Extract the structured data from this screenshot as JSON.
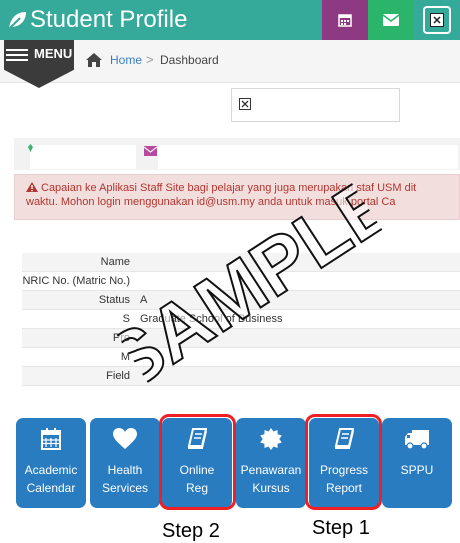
{
  "header": {
    "title": "Student Profile"
  },
  "menu": {
    "label": "MENU"
  },
  "breadcrumb": {
    "home": "Home",
    "separator": ">",
    "current": "Dashboard"
  },
  "alert": {
    "line1": "Capaian ke Aplikasi Staff Site bagi pelajar yang juga merupakan staf USM dit",
    "line2": "waktu. Mohon login menggunakan id@usm.my anda untuk masuk portal Ca"
  },
  "profile": {
    "rows": [
      {
        "label": "Name",
        "value": ""
      },
      {
        "label": "NRIC No. (Matric No.)",
        "value": ""
      },
      {
        "label": "Status",
        "value": "A"
      },
      {
        "label": "S",
        "value": "Graduate School of Business"
      },
      {
        "label": "Pro",
        "value": ""
      },
      {
        "label": "M",
        "value": ""
      },
      {
        "label": "Field",
        "value": ""
      }
    ]
  },
  "tiles": [
    {
      "icon": "calendar-icon",
      "line1": "Academic",
      "line2": "Calendar"
    },
    {
      "icon": "heart-icon",
      "line1": "Health",
      "line2": "Services"
    },
    {
      "icon": "book-icon",
      "line1": "Online",
      "line2": "Reg"
    },
    {
      "icon": "badge-icon",
      "line1": "Penawaran",
      "line2": "Kursus"
    },
    {
      "icon": "book-icon",
      "line1": "Progress",
      "line2": "Report"
    },
    {
      "icon": "truck-icon",
      "line1": "SPPU",
      "line2": ""
    }
  ],
  "annotations": {
    "step2": "Step 2",
    "step1": "Step 1"
  },
  "watermark": "SAMPLE",
  "colors": {
    "header": "#35a99a",
    "calendar_button": "#8e3a83",
    "mail_button": "#2bb56b",
    "tile": "#2a7cc0",
    "highlight": "#ef1f24",
    "alert_text": "#b1362f"
  }
}
